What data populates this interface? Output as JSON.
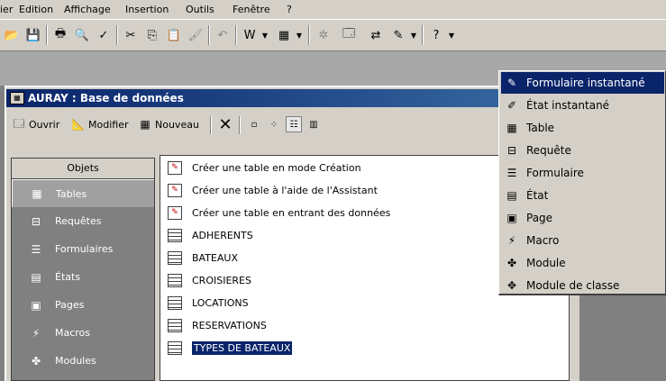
{
  "menubar": {
    "items": [
      {
        "label": "ier"
      },
      {
        "label": "Edition"
      },
      {
        "label": "Affichage"
      },
      {
        "label": "Insertion"
      },
      {
        "label": "Outils"
      },
      {
        "label": "Fenêtre"
      },
      {
        "label": "?"
      }
    ]
  },
  "database_window": {
    "title": "AURAY : Base de données",
    "toolbar": {
      "open": "Ouvrir",
      "modify": "Modifier",
      "new": "Nouveau"
    }
  },
  "objects_bar": {
    "header": "Objets",
    "items": [
      {
        "label": "Tables",
        "icon": "table-icon"
      },
      {
        "label": "Requêtes",
        "icon": "query-icon"
      },
      {
        "label": "Formulaires",
        "icon": "form-icon"
      },
      {
        "label": "États",
        "icon": "report-icon"
      },
      {
        "label": "Pages",
        "icon": "page-icon"
      },
      {
        "label": "Macros",
        "icon": "macro-icon"
      },
      {
        "label": "Modules",
        "icon": "module-icon"
      }
    ]
  },
  "object_list": {
    "items": [
      {
        "label": "Créer une table en mode Création",
        "kind": "wizard"
      },
      {
        "label": "Créer une table à l'aide de l'Assistant",
        "kind": "wizard"
      },
      {
        "label": "Créer une table en entrant des données",
        "kind": "wizard"
      },
      {
        "label": "ADHERENTS",
        "kind": "table"
      },
      {
        "label": "BATEAUX",
        "kind": "table"
      },
      {
        "label": "CROISIERES",
        "kind": "table"
      },
      {
        "label": "LOCATIONS",
        "kind": "table"
      },
      {
        "label": "RESERVATIONS",
        "kind": "table"
      },
      {
        "label": "TYPES DE BATEAUX",
        "kind": "table",
        "selected": true
      }
    ]
  },
  "new_object_menu": {
    "items": [
      {
        "label": "Formulaire instantané",
        "highlighted": true
      },
      {
        "label": "État instantané"
      },
      {
        "label": "Table"
      },
      {
        "label": "Requête"
      },
      {
        "label": "Formulaire"
      },
      {
        "label": "État"
      },
      {
        "label": "Page"
      },
      {
        "label": "Macro"
      },
      {
        "label": "Module"
      },
      {
        "label": "Module de classe"
      }
    ]
  },
  "colors": {
    "face": "#d4d0c8",
    "title_start": "#0a246a",
    "title_end": "#3a6ea5",
    "highlight": "#0a246a",
    "objects_bg": "#808080"
  }
}
